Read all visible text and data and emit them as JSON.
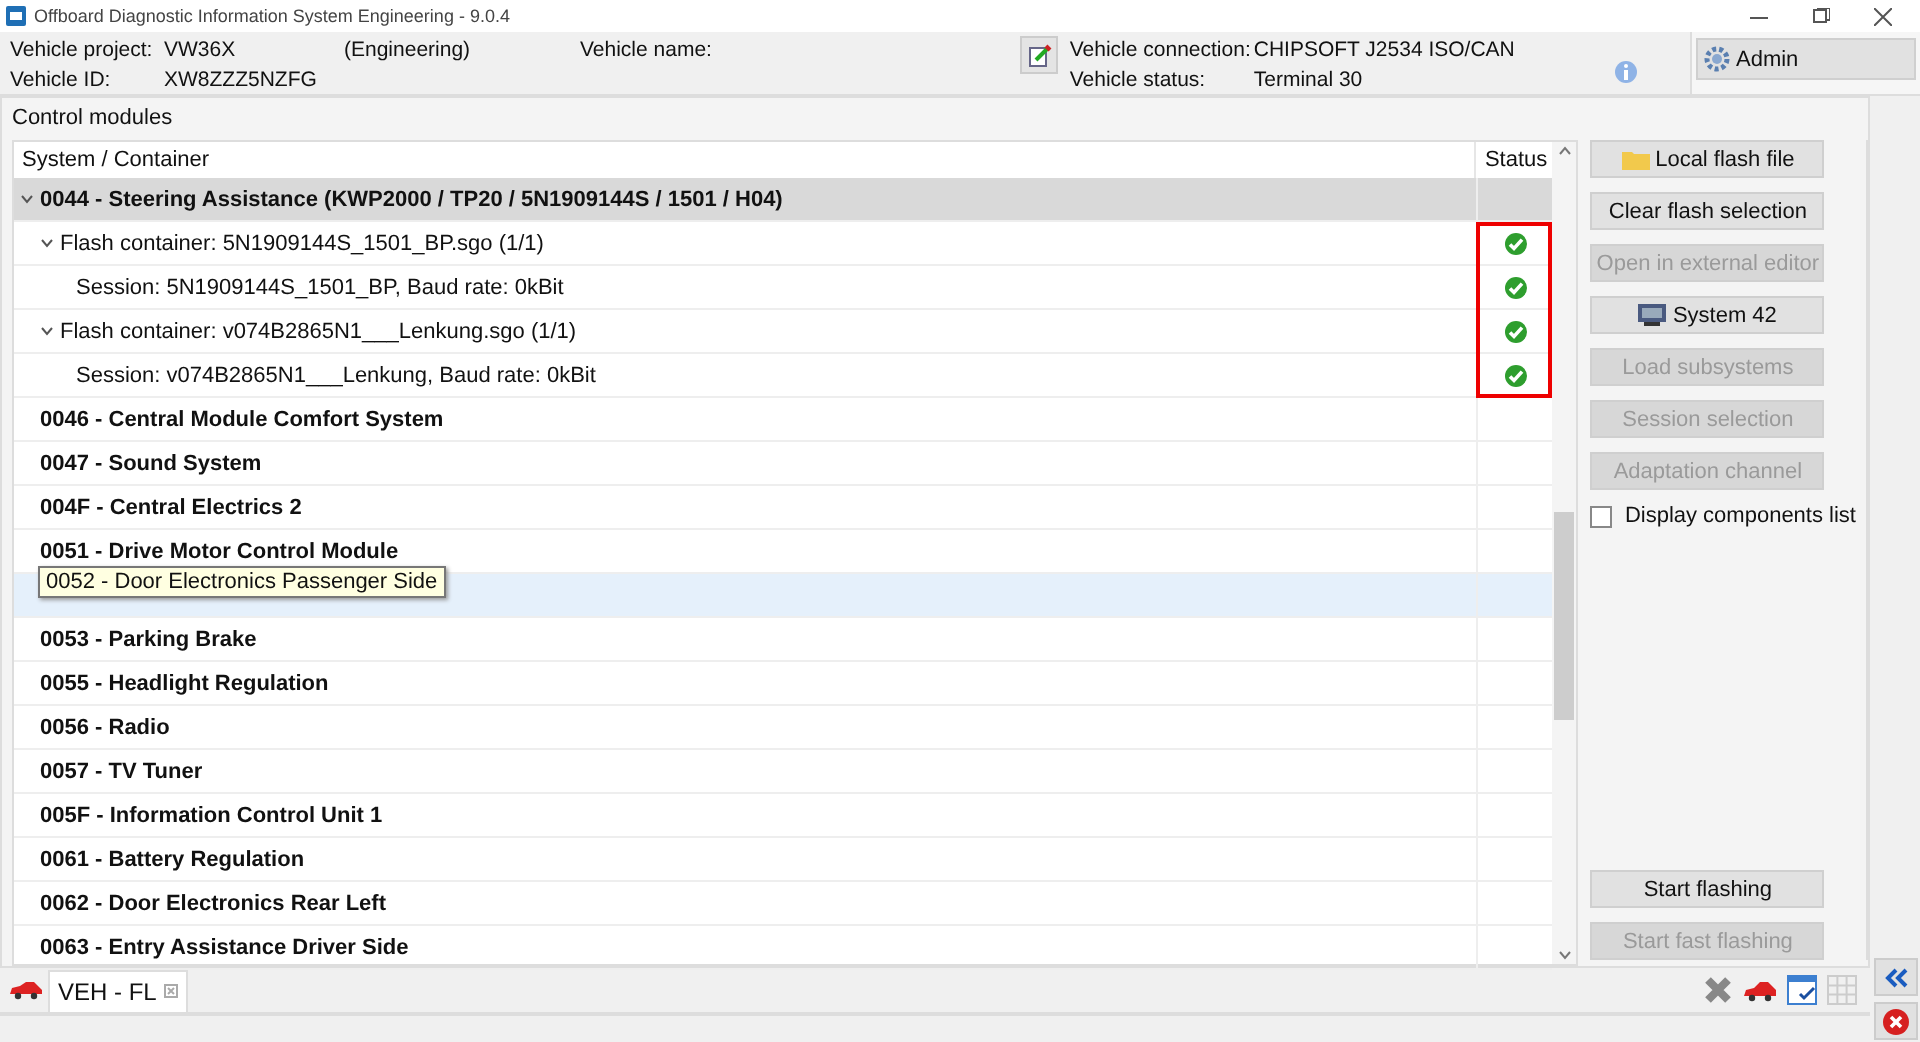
{
  "window": {
    "title": "Offboard Diagnostic Information System Engineering - 9.0.4"
  },
  "vehicle": {
    "project_label": "Vehicle project:",
    "project": "VW36X",
    "edition": "(Engineering)",
    "name_label": "Vehicle name:",
    "id_label": "Vehicle ID:",
    "id": "XW8ZZZ5NZFG",
    "connection_label": "Vehicle connection:",
    "connection": "CHIPSOFT J2534 ISO/CAN",
    "status_label": "Vehicle status:",
    "status": "Terminal 30"
  },
  "admin_button": {
    "label": "Admin"
  },
  "panel": {
    "title": "Control modules"
  },
  "table": {
    "columns": [
      "System / Container",
      "Status"
    ],
    "highlight_status": true,
    "rows": [
      {
        "kind": "module",
        "label": "0044 - Steering Assistance  (KWP2000 / TP20 / 5N1909144S / 1501 / H04)",
        "expanded": true,
        "selected": false,
        "children": [
          {
            "kind": "flash_container",
            "label": "Flash container: 5N1909144S_1501_BP.sgo (1/1)",
            "expanded": true,
            "selected": false,
            "ok": true,
            "children": [
              {
                "kind": "session",
                "label": "Session: 5N1909144S_1501_BP, Baud rate: 0kBit",
                "selected": false,
                "ok": true
              }
            ]
          },
          {
            "kind": "flash_container",
            "label": "Flash container: v074B2865N1___Lenkung.sgo (1/1)",
            "expanded": true,
            "selected": false,
            "ok": true,
            "children": [
              {
                "kind": "session",
                "label": "Session: v074B2865N1___Lenkung, Baud rate: 0kBit",
                "selected": false,
                "ok": true
              }
            ]
          }
        ]
      },
      {
        "kind": "module",
        "label": "0046 - Central Module Comfort System",
        "selected": false
      },
      {
        "kind": "module",
        "label": "0047 - Sound System",
        "selected": false
      },
      {
        "kind": "module",
        "label": "004F - Central Electrics 2",
        "selected": false
      },
      {
        "kind": "module",
        "label": "0051 - Drive Motor Control Module",
        "selected": false
      },
      {
        "kind": "module",
        "selected": true
      },
      {
        "kind": "module",
        "label": "0053 - Parking Brake",
        "selected": false
      },
      {
        "kind": "module",
        "label": "0055 - Headlight Regulation",
        "selected": false
      },
      {
        "kind": "module",
        "label": "0056 - Radio",
        "selected": false
      },
      {
        "kind": "module",
        "label": "0057 - TV Tuner",
        "selected": false
      },
      {
        "kind": "module",
        "label": "005F - Information Control Unit 1",
        "selected": false
      },
      {
        "kind": "module",
        "label": "0061 - Battery Regulation",
        "selected": false
      },
      {
        "kind": "module",
        "label": "0062 - Door Electronics Rear Left",
        "selected": false
      },
      {
        "kind": "module",
        "label": "0063 - Entry Assistance Driver Side",
        "selected": false
      }
    ]
  },
  "tooltip": {
    "text": "0052 - Door Electronics Passenger Side"
  },
  "actions": [
    {
      "label": "Local flash file",
      "disabled": false
    },
    {
      "label": "Clear flash selection",
      "disabled": false
    },
    {
      "label": "Open in external editor",
      "disabled": true
    },
    {
      "label": "System 42",
      "disabled": false
    },
    {
      "label": "Load subsystems",
      "disabled": true
    },
    {
      "label": "Session selection",
      "disabled": true
    },
    {
      "label": "Adaptation channel",
      "disabled": true
    }
  ],
  "components_checkbox": {
    "label": "Display components list",
    "checked": false
  },
  "flash_buttons": [
    {
      "label": "Start flashing",
      "disabled": false
    },
    {
      "label": "Start fast flashing",
      "disabled": true
    }
  ],
  "tabs": [
    {
      "label": "VEH - FL",
      "selected": true
    }
  ]
}
